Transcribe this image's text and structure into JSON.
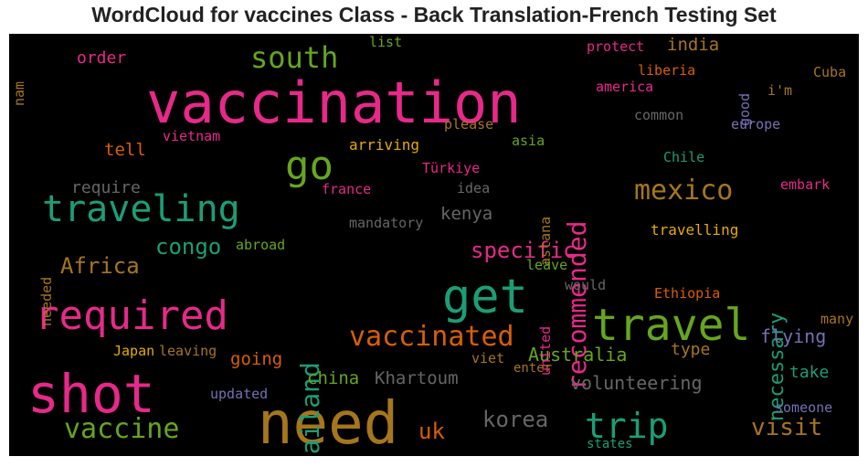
{
  "title": "WordCloud for vaccines Class - Back Translation-French Testing Set",
  "chart_data": {
    "type": "wordcloud",
    "words": [
      {
        "text": "vaccination",
        "color": "#e7298a"
      },
      {
        "text": "need",
        "color": "#a6761d"
      },
      {
        "text": "shot",
        "color": "#e7298a"
      },
      {
        "text": "get",
        "color": "#1b9e77"
      },
      {
        "text": "travel",
        "color": "#66a61e"
      },
      {
        "text": "required",
        "color": "#e7298a"
      },
      {
        "text": "traveling",
        "color": "#1b9e77"
      },
      {
        "text": "go",
        "color": "#66a61e"
      },
      {
        "text": "trip",
        "color": "#1b9e77"
      },
      {
        "text": "vaccine",
        "color": "#66a61e"
      },
      {
        "text": "south",
        "color": "#66a61e"
      },
      {
        "text": "recommended",
        "color": "#e7298a"
      },
      {
        "text": "mexico",
        "color": "#a6761d"
      },
      {
        "text": "vaccinated",
        "color": "#d95f02"
      },
      {
        "text": "thailand",
        "color": "#1b9e77"
      },
      {
        "text": "korea",
        "color": "#666666"
      },
      {
        "text": "visit",
        "color": "#a6761d"
      },
      {
        "text": "specific",
        "color": "#e7298a"
      },
      {
        "text": "congo",
        "color": "#1b9e77"
      },
      {
        "text": "Africa",
        "color": "#a6761d"
      },
      {
        "text": "uk",
        "color": "#d95f02"
      },
      {
        "text": "necessary",
        "color": "#1b9e77"
      },
      {
        "text": "volunteering",
        "color": "#666666"
      },
      {
        "text": "flying",
        "color": "#7570b3"
      },
      {
        "text": "Australia",
        "color": "#66a61e"
      },
      {
        "text": "Khartoum",
        "color": "#666666"
      },
      {
        "text": "china",
        "color": "#66a61e"
      },
      {
        "text": "going",
        "color": "#d95f02"
      },
      {
        "text": "take",
        "color": "#1b9e77"
      },
      {
        "text": "type",
        "color": "#a6761d"
      },
      {
        "text": "kenya",
        "color": "#666666"
      },
      {
        "text": "require",
        "color": "#666666"
      },
      {
        "text": "tell",
        "color": "#d95f02"
      },
      {
        "text": "order",
        "color": "#e7298a"
      },
      {
        "text": "india",
        "color": "#a6761d"
      },
      {
        "text": "travelling",
        "color": "#e6ab02"
      },
      {
        "text": "arriving",
        "color": "#e6ab02"
      },
      {
        "text": "list",
        "color": "#66a61e"
      },
      {
        "text": "nam",
        "color": "#a6761d"
      },
      {
        "text": "protect",
        "color": "#e7298a"
      },
      {
        "text": "liberia",
        "color": "#d95f02"
      },
      {
        "text": "Cuba",
        "color": "#a6761d"
      },
      {
        "text": "america",
        "color": "#e7298a"
      },
      {
        "text": "good",
        "color": "#7570b3"
      },
      {
        "text": "i'm",
        "color": "#a6761d"
      },
      {
        "text": "common",
        "color": "#666666"
      },
      {
        "text": "europe",
        "color": "#7570b3"
      },
      {
        "text": "please",
        "color": "#a6761d"
      },
      {
        "text": "asia",
        "color": "#66a61e"
      },
      {
        "text": "vietnam",
        "color": "#e7298a"
      },
      {
        "text": "Chile",
        "color": "#1b9e77"
      },
      {
        "text": "Türkiye",
        "color": "#e7298a"
      },
      {
        "text": "astana",
        "color": "#a6761d"
      },
      {
        "text": "france",
        "color": "#e7298a"
      },
      {
        "text": "idea",
        "color": "#666666"
      },
      {
        "text": "embark",
        "color": "#e7298a"
      },
      {
        "text": "mandatory",
        "color": "#666666"
      },
      {
        "text": "abroad",
        "color": "#66a61e"
      },
      {
        "text": "needed",
        "color": "#a6761d"
      },
      {
        "text": "leave",
        "color": "#66a61e"
      },
      {
        "text": "would",
        "color": "#666666"
      },
      {
        "text": "united",
        "color": "#e7298a"
      },
      {
        "text": "Ethiopia",
        "color": "#d95f02"
      },
      {
        "text": "many",
        "color": "#a6761d"
      },
      {
        "text": "Japan",
        "color": "#e6ab02"
      },
      {
        "text": "leaving",
        "color": "#a6761d"
      },
      {
        "text": "viet",
        "color": "#a6761d"
      },
      {
        "text": "enter",
        "color": "#a6761d"
      },
      {
        "text": "updated",
        "color": "#7570b3"
      },
      {
        "text": "someone",
        "color": "#7570b3"
      },
      {
        "text": "states",
        "color": "#1b9e77"
      }
    ]
  }
}
